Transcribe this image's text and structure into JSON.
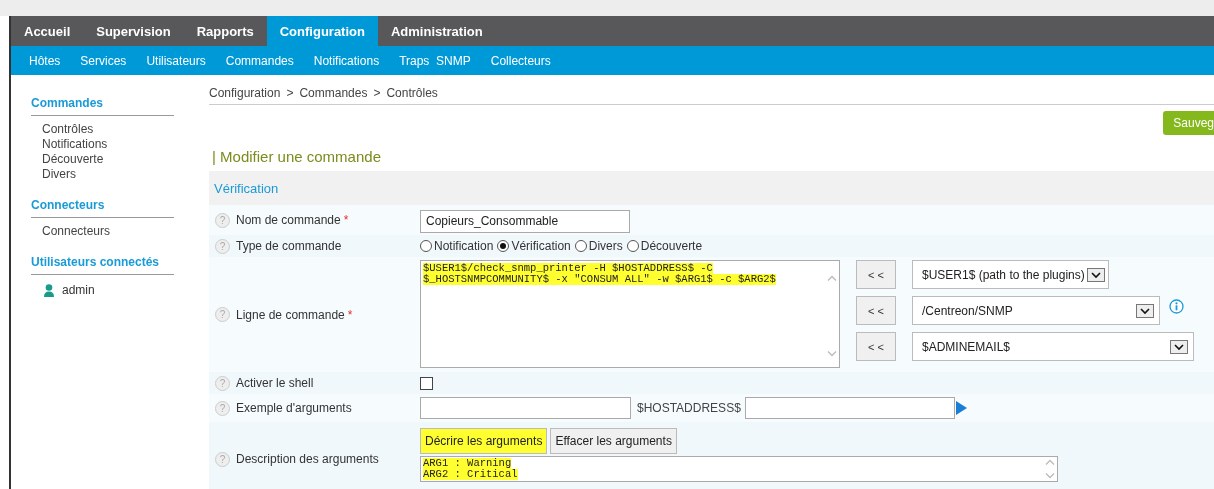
{
  "main_nav": [
    {
      "label": "Accueil",
      "selected": false
    },
    {
      "label": "Supervision",
      "selected": false
    },
    {
      "label": "Rapports",
      "selected": false
    },
    {
      "label": "Configuration",
      "selected": true
    },
    {
      "label": "Administration",
      "selected": false
    }
  ],
  "sub_nav": [
    "Hôtes",
    "Services",
    "Utilisateurs",
    "Commandes",
    "Notifications",
    "Traps  SNMP",
    "Collecteurs"
  ],
  "sidebar": [
    {
      "title": "Commandes",
      "items": [
        {
          "kind": "link",
          "label": "Contrôles"
        },
        {
          "kind": "link",
          "label": "Notifications"
        },
        {
          "kind": "link",
          "label": "Découverte"
        },
        {
          "kind": "link",
          "label": "Divers"
        }
      ]
    },
    {
      "title": "Connecteurs",
      "items": [
        {
          "kind": "link",
          "label": "Connecteurs"
        }
      ]
    },
    {
      "title": "Utilisateurs connectés",
      "items": [
        {
          "kind": "user",
          "label": "admin"
        }
      ]
    }
  ],
  "breadcrumb": {
    "items": [
      "Configuration",
      "Commandes",
      "Contrôles"
    ],
    "separator": ">"
  },
  "save_button": "Sauveg",
  "help_icon": "?",
  "required_mark": "*",
  "page_title": "| Modifier une commande",
  "section_title": "Vérification",
  "form": [
    {
      "kind": "text",
      "label": "Nom de commande",
      "required": true,
      "value": "Copieurs_Consommable"
    },
    {
      "kind": "radio",
      "label": "Type de commande",
      "required": false,
      "options": [
        {
          "label": "Notification",
          "selected": false
        },
        {
          "label": "Vérification",
          "selected": true
        },
        {
          "label": "Divers",
          "selected": false
        },
        {
          "label": "Découverte",
          "selected": false
        }
      ]
    },
    {
      "kind": "command",
      "label": "Ligne de commande",
      "required": true,
      "highlighted": true,
      "lines": [
        "$USER1$/check_snmp_printer -H $HOSTADDRESS$ -C",
        "$_HOSTSNMPCOMMUNITY$ -x \"CONSUM ALL\" -w $ARG1$ -c $ARG2$"
      ],
      "macros": [
        {
          "button": "< <",
          "value": "$USER1$ (path to the plugins)",
          "info": false
        },
        {
          "button": "< <",
          "value": "/Centreon/SNMP",
          "info": true
        },
        {
          "button": "< <",
          "value": "$ADMINEMAIL$",
          "info": false
        }
      ]
    },
    {
      "kind": "checkbox",
      "label": "Activer le shell",
      "required": false,
      "checked": false
    },
    {
      "kind": "example",
      "label": "Exemple d'arguments",
      "required": false,
      "second_label": "$HOSTADDRESS$"
    },
    {
      "kind": "description",
      "label": "Description des arguments",
      "required": false,
      "buttons": [
        {
          "label": "Décrire les arguments",
          "highlighted": true
        },
        {
          "label": "Effacer les arguments",
          "highlighted": false
        }
      ],
      "highlighted": true,
      "lines": [
        "ARG1 : Warning",
        "ARG2 : Critical"
      ]
    }
  ]
}
